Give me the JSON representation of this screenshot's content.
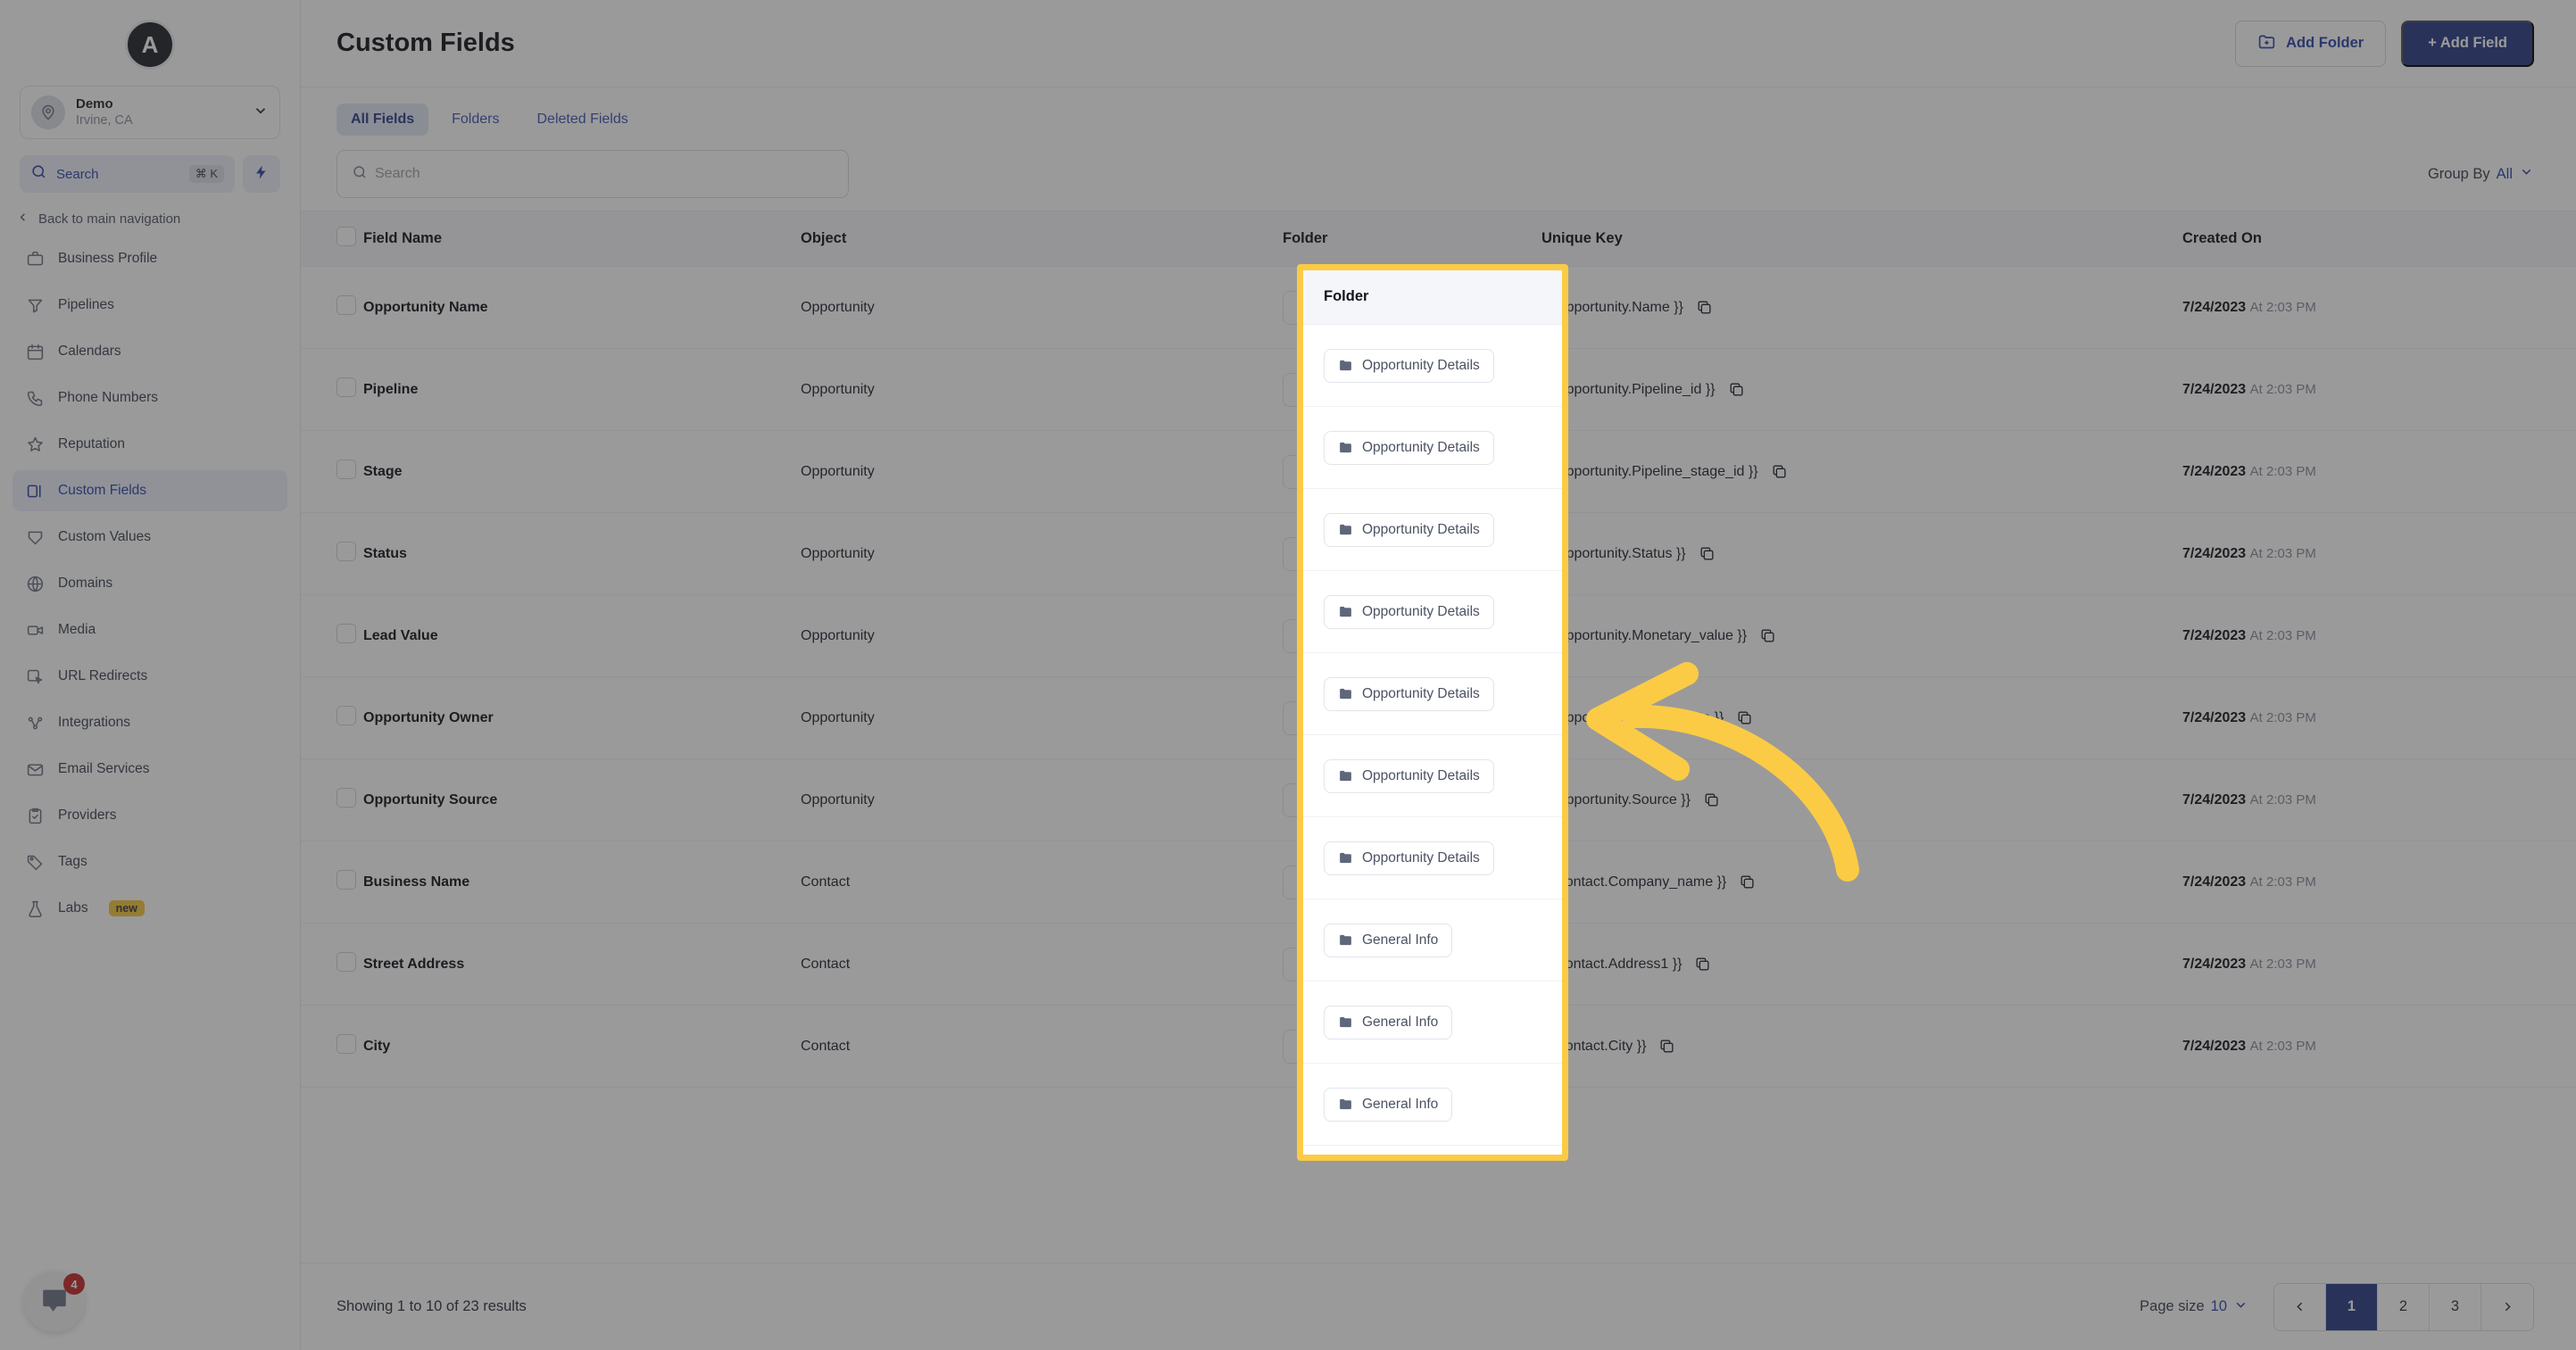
{
  "sidebar": {
    "logo_letter": "A",
    "account": {
      "name": "Demo",
      "location": "Irvine, CA"
    },
    "search": {
      "label": "Search",
      "shortcut": "⌘ K"
    },
    "back_label": "Back to main navigation",
    "items": [
      {
        "label": "Business Profile",
        "icon": "briefcase-icon",
        "active": false
      },
      {
        "label": "Pipelines",
        "icon": "funnel-icon",
        "active": false
      },
      {
        "label": "Calendars",
        "icon": "calendar-icon",
        "active": false
      },
      {
        "label": "Phone Numbers",
        "icon": "phone-icon",
        "active": false
      },
      {
        "label": "Reputation",
        "icon": "star-icon",
        "active": false
      },
      {
        "label": "Custom Fields",
        "icon": "fields-icon",
        "active": true
      },
      {
        "label": "Custom Values",
        "icon": "shield-icon",
        "active": false
      },
      {
        "label": "Domains",
        "icon": "globe-icon",
        "active": false
      },
      {
        "label": "Media",
        "icon": "video-icon",
        "active": false
      },
      {
        "label": "URL Redirects",
        "icon": "cursor-icon",
        "active": false
      },
      {
        "label": "Integrations",
        "icon": "nodes-icon",
        "active": false
      },
      {
        "label": "Email Services",
        "icon": "envelope-icon",
        "active": false
      },
      {
        "label": "Providers",
        "icon": "clipboard-check-icon",
        "active": false
      },
      {
        "label": "Tags",
        "icon": "tag-icon",
        "active": false
      },
      {
        "label": "Labs",
        "icon": "flask-icon",
        "active": false,
        "badge": "new"
      }
    ],
    "chat": {
      "unread": "4"
    }
  },
  "header": {
    "title": "Custom Fields",
    "add_folder_label": "Add Folder",
    "add_field_label": "+ Add Field"
  },
  "tabs": [
    {
      "label": "All Fields",
      "active": true
    },
    {
      "label": "Folders",
      "active": false
    },
    {
      "label": "Deleted Fields",
      "active": false
    }
  ],
  "toolbar": {
    "search_placeholder": "Search",
    "group_by_label": "Group By",
    "group_by_value": "All"
  },
  "table": {
    "columns": [
      "Field Name",
      "Object",
      "Folder",
      "Unique Key",
      "Created On"
    ],
    "rows": [
      {
        "name": "Opportunity Name",
        "object": "Opportunity",
        "folder": "Opportunity Details",
        "key": "{{ Opportunity.Name }}",
        "date": "7/24/2023",
        "time": "At 2:03 PM"
      },
      {
        "name": "Pipeline",
        "object": "Opportunity",
        "folder": "Opportunity Details",
        "key": "{{ Opportunity.Pipeline_id }}",
        "date": "7/24/2023",
        "time": "At 2:03 PM"
      },
      {
        "name": "Stage",
        "object": "Opportunity",
        "folder": "Opportunity Details",
        "key": "{{ Opportunity.Pipeline_stage_id }}",
        "date": "7/24/2023",
        "time": "At 2:03 PM"
      },
      {
        "name": "Status",
        "object": "Opportunity",
        "folder": "Opportunity Details",
        "key": "{{ Opportunity.Status }}",
        "date": "7/24/2023",
        "time": "At 2:03 PM"
      },
      {
        "name": "Lead Value",
        "object": "Opportunity",
        "folder": "Opportunity Details",
        "key": "{{ Opportunity.Monetary_value }}",
        "date": "7/24/2023",
        "time": "At 2:03 PM"
      },
      {
        "name": "Opportunity Owner",
        "object": "Opportunity",
        "folder": "Opportunity Details",
        "key": "{{ Opportunity.Assigned_to }}",
        "date": "7/24/2023",
        "time": "At 2:03 PM"
      },
      {
        "name": "Opportunity Source",
        "object": "Opportunity",
        "folder": "Opportunity Details",
        "key": "{{ Opportunity.Source }}",
        "date": "7/24/2023",
        "time": "At 2:03 PM"
      },
      {
        "name": "Business Name",
        "object": "Contact",
        "folder": "General Info",
        "key": "{{ Contact.Company_name }}",
        "date": "7/24/2023",
        "time": "At 2:03 PM"
      },
      {
        "name": "Street Address",
        "object": "Contact",
        "folder": "General Info",
        "key": "{{ Contact.Address1 }}",
        "date": "7/24/2023",
        "time": "At 2:03 PM"
      },
      {
        "name": "City",
        "object": "Contact",
        "folder": "General Info",
        "key": "{{ Contact.City }}",
        "date": "7/24/2023",
        "time": "At 2:03 PM"
      }
    ]
  },
  "footer": {
    "results_text": "Showing 1 to 10 of 23 results",
    "page_size_label": "Page size",
    "page_size_value": "10",
    "pages": [
      "1",
      "2",
      "3"
    ],
    "current_page": "1"
  },
  "annotation": {
    "highlight_color": "#fbcb45",
    "highlight_target": "Folder",
    "arrow_color": "#fbcb45"
  }
}
